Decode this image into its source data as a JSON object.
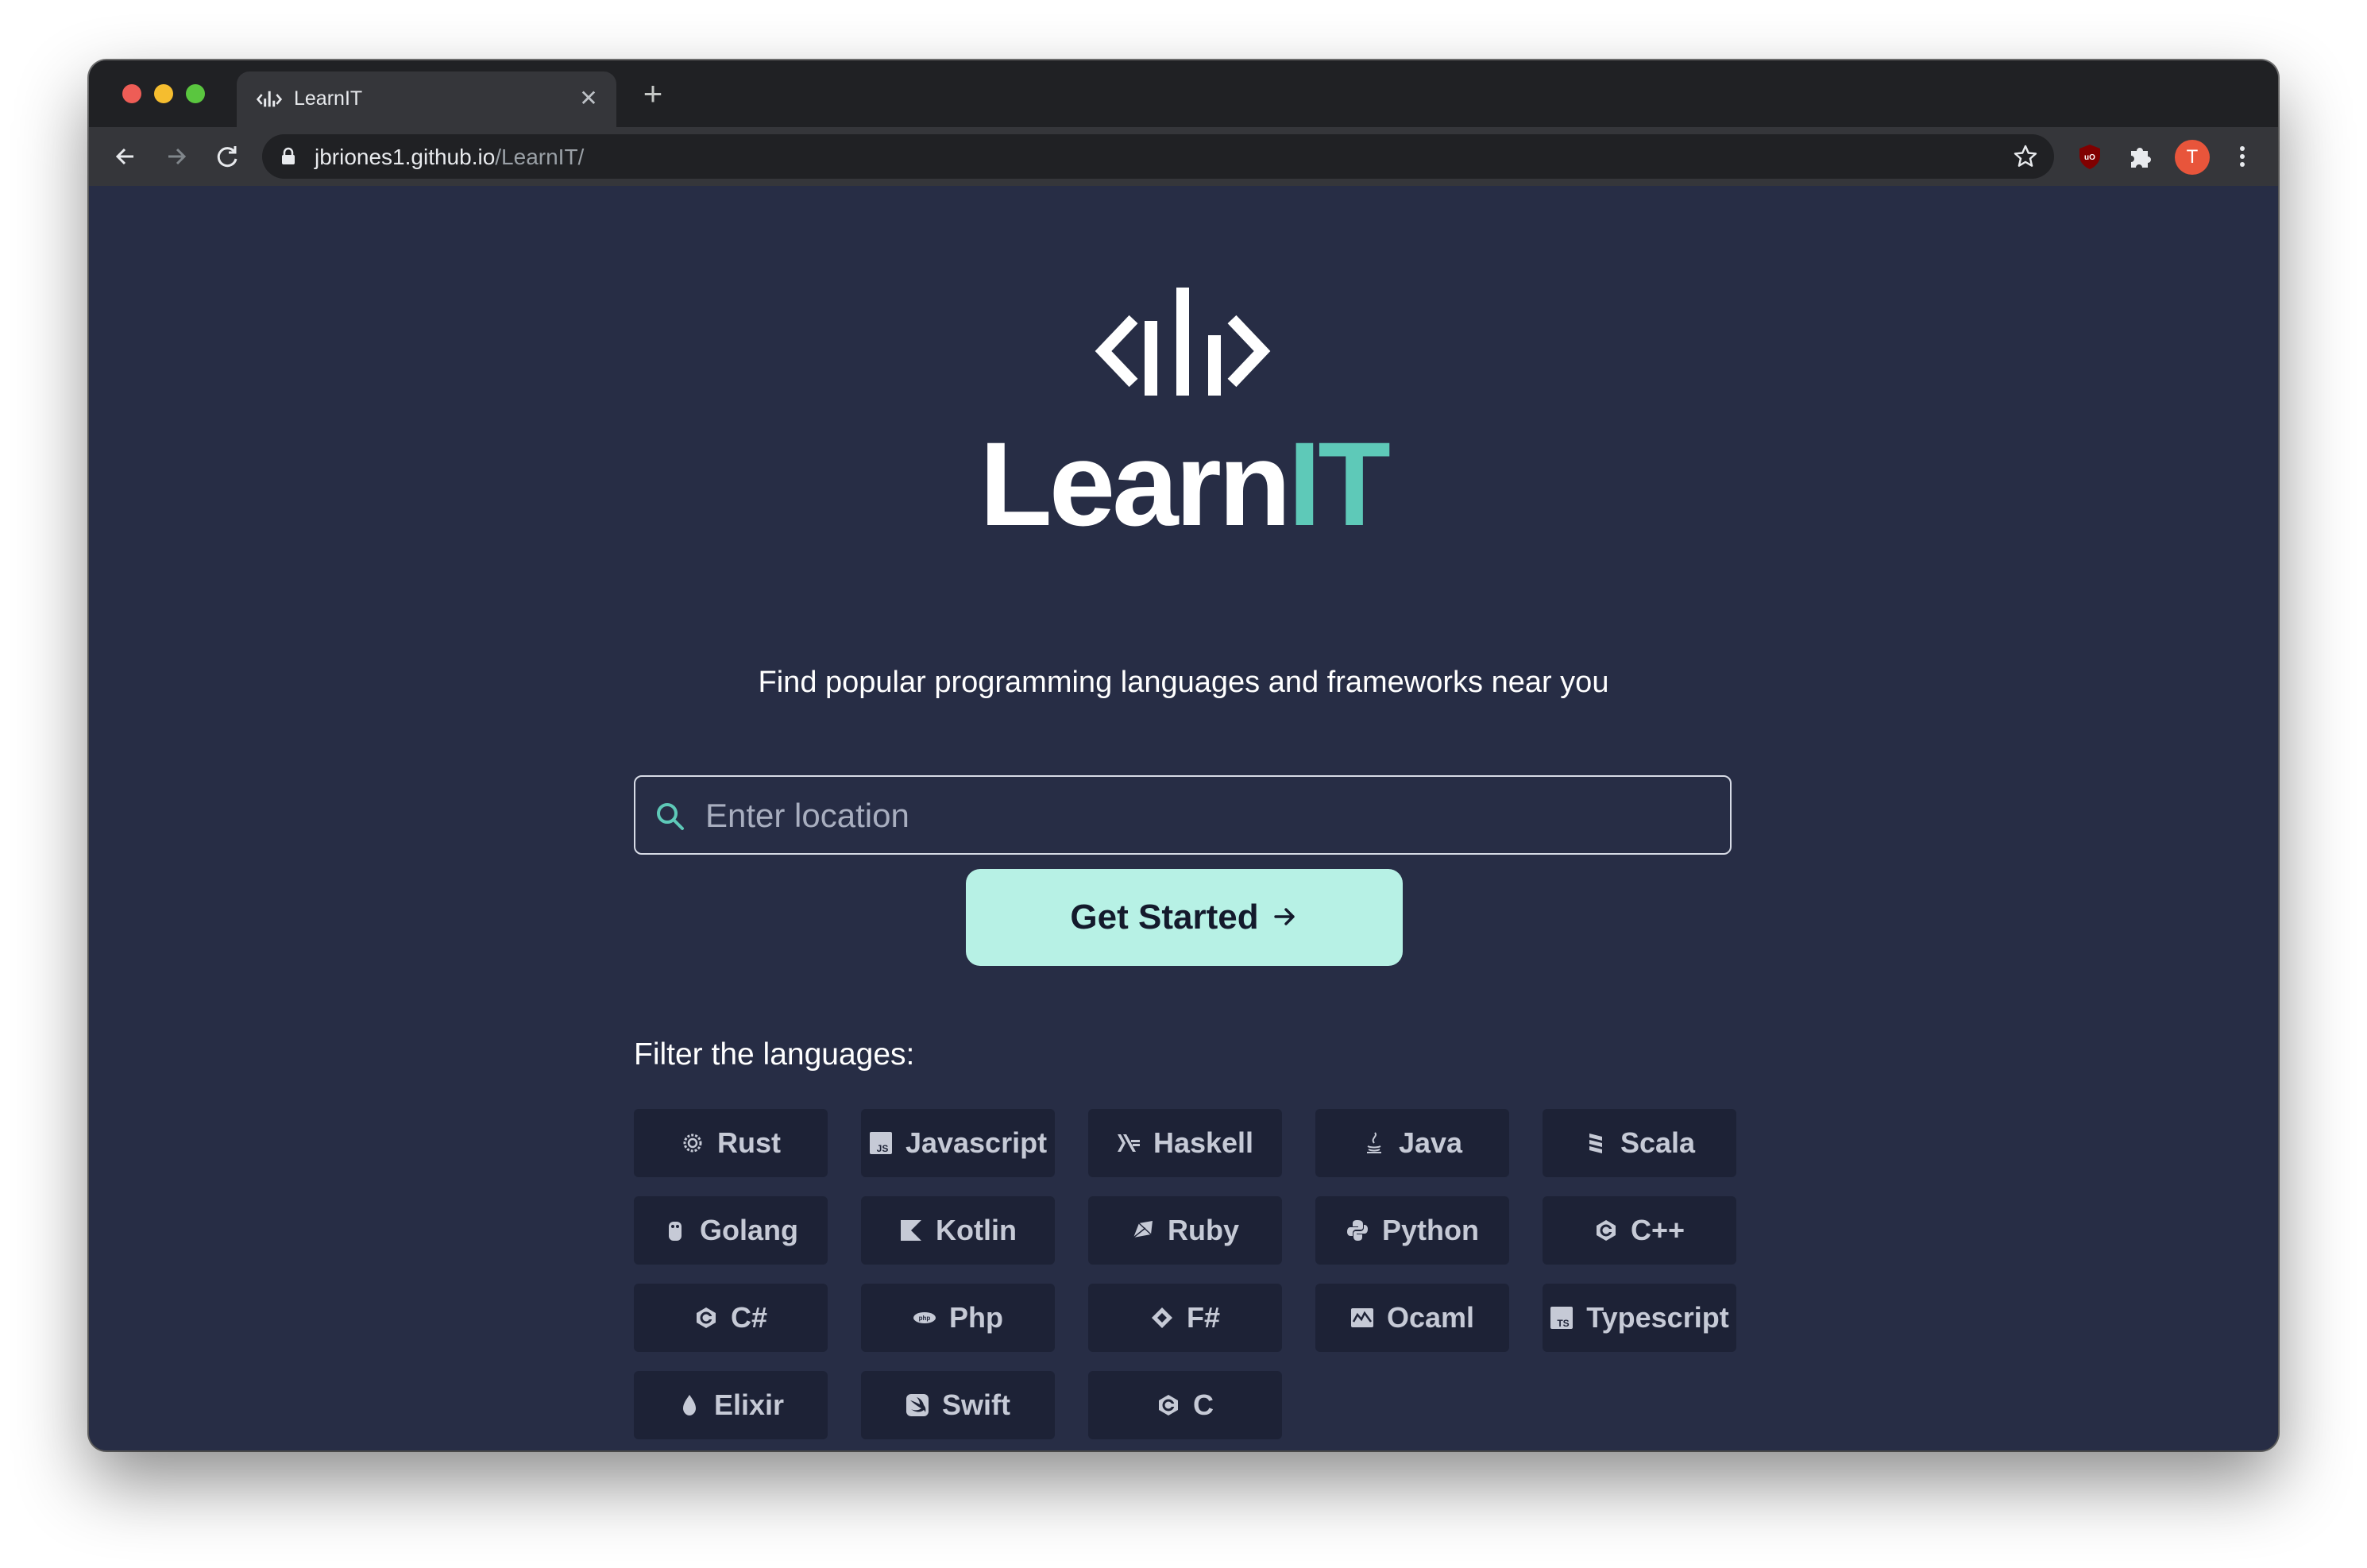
{
  "browser": {
    "tab_title": "LearnIT",
    "url_host": "jbriones1.github.io",
    "url_path": "/LearnIT/",
    "profile_initial": "T",
    "extensions": [
      "ublock-origin",
      "extensions-puzzle"
    ]
  },
  "hero": {
    "brand_main": "Learn",
    "brand_accent": "IT",
    "tagline": "Find popular programming languages and frameworks near you"
  },
  "search": {
    "placeholder": "Enter location",
    "value": ""
  },
  "cta": {
    "label": "Get Started"
  },
  "filter": {
    "label": "Filter the languages:",
    "languages": [
      {
        "name": "Rust",
        "icon": "rust-icon"
      },
      {
        "name": "Javascript",
        "icon": "javascript-icon"
      },
      {
        "name": "Haskell",
        "icon": "haskell-icon"
      },
      {
        "name": "Java",
        "icon": "java-icon"
      },
      {
        "name": "Scala",
        "icon": "scala-icon"
      },
      {
        "name": "Golang",
        "icon": "golang-icon"
      },
      {
        "name": "Kotlin",
        "icon": "kotlin-icon"
      },
      {
        "name": "Ruby",
        "icon": "ruby-icon"
      },
      {
        "name": "Python",
        "icon": "python-icon"
      },
      {
        "name": "C++",
        "icon": "cplusplus-icon"
      },
      {
        "name": "C#",
        "icon": "csharp-icon"
      },
      {
        "name": "Php",
        "icon": "php-icon"
      },
      {
        "name": "F#",
        "icon": "fsharp-icon"
      },
      {
        "name": "Ocaml",
        "icon": "ocaml-icon"
      },
      {
        "name": "Typescript",
        "icon": "typescript-icon"
      },
      {
        "name": "Elixir",
        "icon": "elixir-icon"
      },
      {
        "name": "Swift",
        "icon": "swift-icon"
      },
      {
        "name": "C",
        "icon": "c-icon"
      }
    ]
  },
  "colors": {
    "page_bg": "#272d45",
    "accent": "#5ec9b8",
    "cta_bg": "#b7f1e5",
    "chip_bg": "#1d2236",
    "chip_text": "#c6cad6"
  }
}
